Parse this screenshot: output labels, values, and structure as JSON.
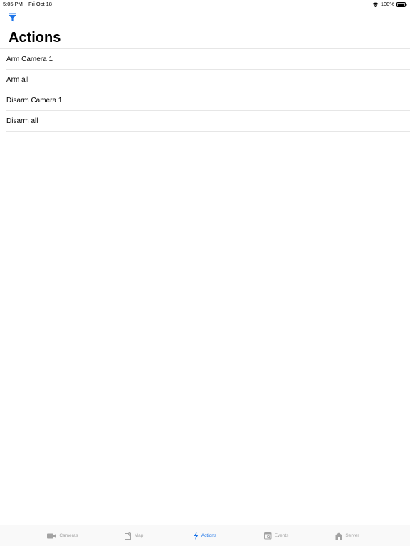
{
  "status_bar": {
    "time": "5:05 PM",
    "date": "Fri Oct 18",
    "battery": "100%"
  },
  "nav": {
    "filter_icon": "filter-icon"
  },
  "page": {
    "title": "Actions"
  },
  "actions": [
    {
      "label": "Arm Camera 1"
    },
    {
      "label": "Arm all"
    },
    {
      "label": "Disarm Camera 1"
    },
    {
      "label": "Disarm all"
    }
  ],
  "tab_bar": {
    "active": "Actions",
    "tabs": [
      {
        "label": "Cameras",
        "icon": "video-camera-icon"
      },
      {
        "label": "Map",
        "icon": "map-icon"
      },
      {
        "label": "Actions",
        "icon": "lightning-bolt-icon"
      },
      {
        "label": "Events",
        "icon": "events-icon"
      },
      {
        "label": "Server",
        "icon": "server-icon"
      }
    ]
  },
  "colors": {
    "accent": "#1a73e8",
    "inactive": "#a3a3a3",
    "separator": "#e6e6e6"
  }
}
